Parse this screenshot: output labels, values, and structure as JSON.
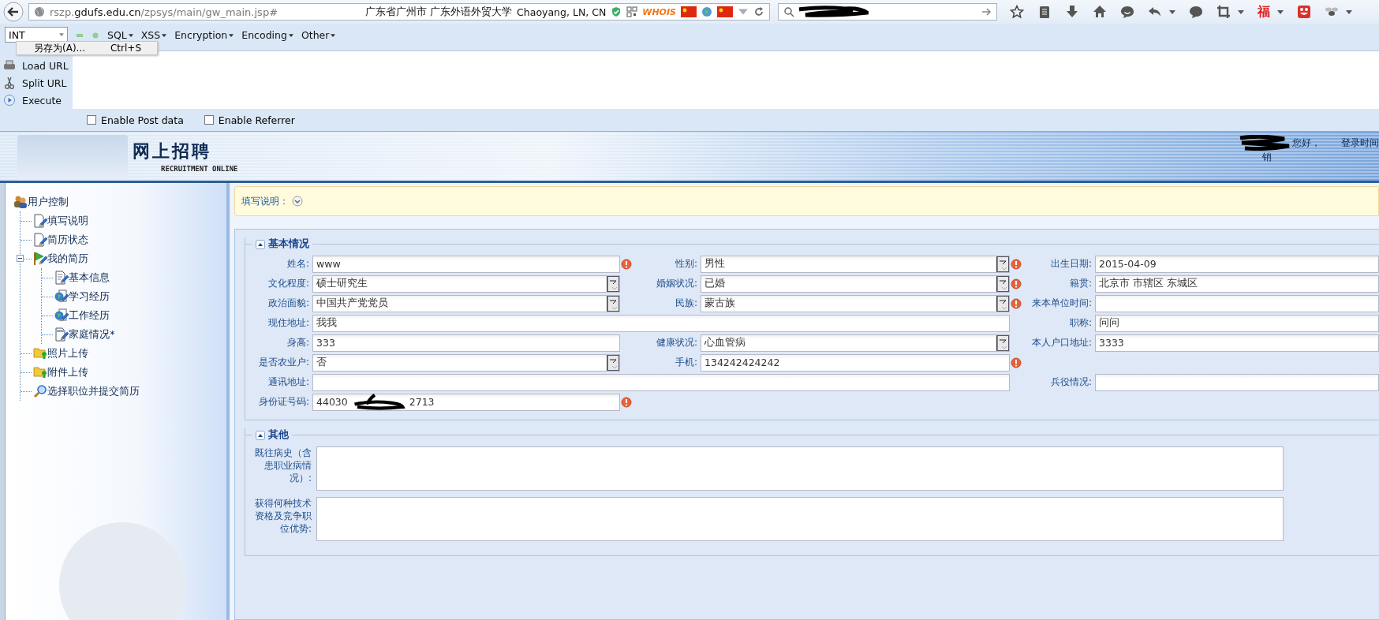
{
  "browser": {
    "url": {
      "subdomain": "rszp.",
      "domain": "gdufs.edu.cn",
      "path": "/zpsys/main/gw_main.jsp#"
    },
    "location": "广东省广州市 广东外语外贸大学",
    "geo": "Chaoyang, LN, CN",
    "whois": "WHOIS",
    "toolbar_glyph": "福"
  },
  "hackbar": {
    "menus": [
      {
        "label": "INT",
        "kind": "dropdown"
      },
      {
        "label": "SQL",
        "kind": "menu"
      },
      {
        "label": "XSS",
        "kind": "menu"
      },
      {
        "label": "Encryption",
        "kind": "menu"
      },
      {
        "label": "Encoding",
        "kind": "menu"
      },
      {
        "label": "Other",
        "kind": "menu"
      }
    ],
    "context_menu": {
      "label": "另存为(A)...",
      "shortcut": "Ctrl+S"
    },
    "actions": [
      {
        "label": "Load URL",
        "kind": "load"
      },
      {
        "label": "Split URL",
        "kind": "split"
      },
      {
        "label": "Execute",
        "kind": "execute"
      }
    ],
    "options": [
      {
        "label": "Enable Post data",
        "checked": false
      },
      {
        "label": "Enable Referrer",
        "checked": false
      }
    ]
  },
  "banner": {
    "title": "网上招聘",
    "subtitle": "RECRUITMENT ONLINE",
    "greeting": "您好，",
    "login_time": "登录时间",
    "logout_fragment": "销"
  },
  "sidebar": {
    "tree": [
      {
        "label": "用户控制",
        "kind": "users",
        "children": [
          {
            "label": "填写说明",
            "kind": "page"
          },
          {
            "label": "简历状态",
            "kind": "page"
          },
          {
            "label": "我的简历",
            "kind": "flag",
            "expanded": true,
            "children": [
              {
                "label": "基本信息",
                "kind": "form"
              },
              {
                "label": "学习经历",
                "kind": "globe"
              },
              {
                "label": "工作经历",
                "kind": "globe"
              },
              {
                "label": "家庭情况*",
                "kind": "calendar"
              }
            ]
          },
          {
            "label": "照片上传",
            "kind": "folder"
          },
          {
            "label": "附件上传",
            "kind": "folder"
          },
          {
            "label": "选择职位并提交简历",
            "kind": "search"
          }
        ]
      }
    ]
  },
  "notice": {
    "label": "填写说明："
  },
  "sections": [
    {
      "title": "基本情况",
      "expanded": true,
      "rows": [
        {
          "cells": [
            {
              "label": "姓名:",
              "value": "www",
              "kind": "text",
              "required": true
            },
            {
              "label": "性别:",
              "value": "男性",
              "kind": "select",
              "required": true
            },
            {
              "label": "出生日期:",
              "value": "2015-04-09",
              "kind": "text",
              "required": false
            }
          ]
        },
        {
          "cells": [
            {
              "label": "文化程度:",
              "value": "硕士研究生",
              "kind": "select",
              "required": false
            },
            {
              "label": "婚姻状况:",
              "value": "已婚",
              "kind": "select",
              "required": true
            },
            {
              "label": "籍贯:",
              "value": "北京市 市辖区 东城区",
              "kind": "text",
              "required": false
            }
          ]
        },
        {
          "cells": [
            {
              "label": "政治面貌:",
              "value": "中国共产党党员",
              "kind": "select",
              "required": false
            },
            {
              "label": "民族:",
              "value": "蒙古族",
              "kind": "select",
              "required": true
            },
            {
              "label": "来本单位时间:",
              "kind": "text",
              "required": false
            }
          ]
        },
        {
          "cells": [
            {
              "label": "现住地址:",
              "value": "我我",
              "kind": "wide",
              "required": false
            },
            {
              "label": "职称:",
              "value": "问问",
              "kind": "text",
              "required": false
            }
          ]
        },
        {
          "cells": [
            {
              "label": "身高:",
              "value": "333",
              "kind": "text",
              "required": false
            },
            {
              "label": "健康状况:",
              "value": "心血管病",
              "kind": "select",
              "required": false
            },
            {
              "label": "本人户口地址:",
              "value": "3333",
              "kind": "text",
              "required": false
            }
          ]
        },
        {
          "cells": [
            {
              "label": "是否农业户:",
              "value": "否",
              "kind": "select",
              "required": false
            },
            {
              "label": "手机:",
              "value": "134242424242",
              "kind": "text",
              "required": true
            }
          ]
        },
        {
          "cells": [
            {
              "label": "通讯地址:",
              "kind": "wide",
              "required": false
            },
            {
              "label": "兵役情况:",
              "kind": "text",
              "required": false
            }
          ]
        },
        {
          "cells": [
            {
              "label": "身份证号码:",
              "value": "44030",
              "value_end": "2713",
              "kind": "redacted",
              "required": true
            }
          ]
        }
      ]
    },
    {
      "title": "其他",
      "expanded": true,
      "textareas": [
        {
          "label": "既往病史（含患职业病情况）:"
        },
        {
          "label": "获得何种技术资格及竞争职位优势:"
        }
      ]
    }
  ]
}
